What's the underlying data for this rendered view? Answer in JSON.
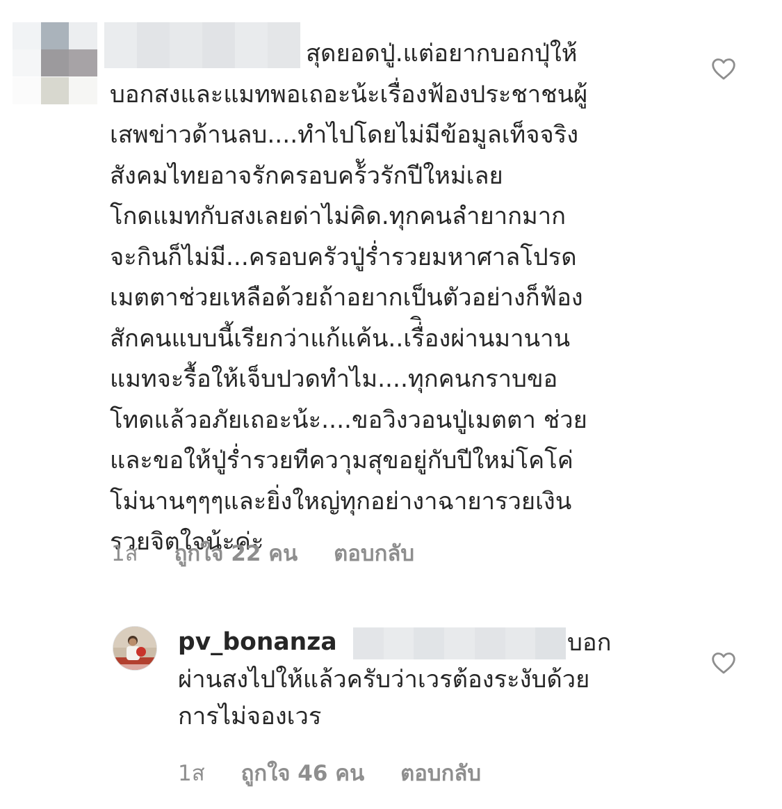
{
  "comment_1": {
    "lines": [
      "สุดยอดปู่.แต่อยากบอกปุ่ให้",
      "บอกสงและแมทพอเถอะน้ะเรื่องฟ้องประชาชนผู้",
      "เสพข่าวด้านลบ....ทำไปโดยไม่มีข้อมูลเท็จจริง",
      "สังคมไทยอาจรักครอบคร้ัวรักปีใหม่เลย",
      "โกดแมทกับสงเลยด่าไม่คิด.ทุกคนลำยากมาก",
      "จะกินก็ไม่มี...ครอบครัวปู่ร่ำรวยมหาศาลโปรด",
      "เมตตาช่วยเหลือด้วยถ้าอยากเป็นตัวอย่างก็ฟ้อง",
      "สักคนแบบนี้เรียกว่าแก้แค้น..เรื่ิองผ่านมานาน",
      "แมทจะรื้อให้เจ็บปวดทำไม....ทุกคนกราบขอ",
      "โทดแล้วอภัยเถอะน้ะ....ขอวิงวอนปู่เมตตา ช่วย",
      "และขอให้ปู่ร่ำรวยทีควาุมสุขอยู่กับปีใหม่โคโค่",
      "โม่นานๆๆๆและยิ่งใหญ่ทุกอย่างาฉายารวยเงิน",
      "รวยจิตใจน้ะค่ะ"
    ],
    "time": "1ส",
    "likes": "ถูกใจ 22 คน",
    "reply": "ตอบกลับ",
    "heart_icon": "heart-outline-icon"
  },
  "comment_2": {
    "username": "pv_bonanza",
    "lines": [
      "บอก",
      "ผ่านสงไปให้แล้วครับว่าเวรต้องระงับด้วย",
      "การไม่จองเวร"
    ],
    "time": "1ส",
    "likes": "ถูกใจ 46 คน",
    "reply": "ตอบกลับ",
    "heart_icon": "heart-outline-icon"
  },
  "colors": {
    "text": "#262626",
    "meta": "#8e8e8e",
    "icon": "#8e8e8e",
    "redaction": "#e4e6ea"
  }
}
